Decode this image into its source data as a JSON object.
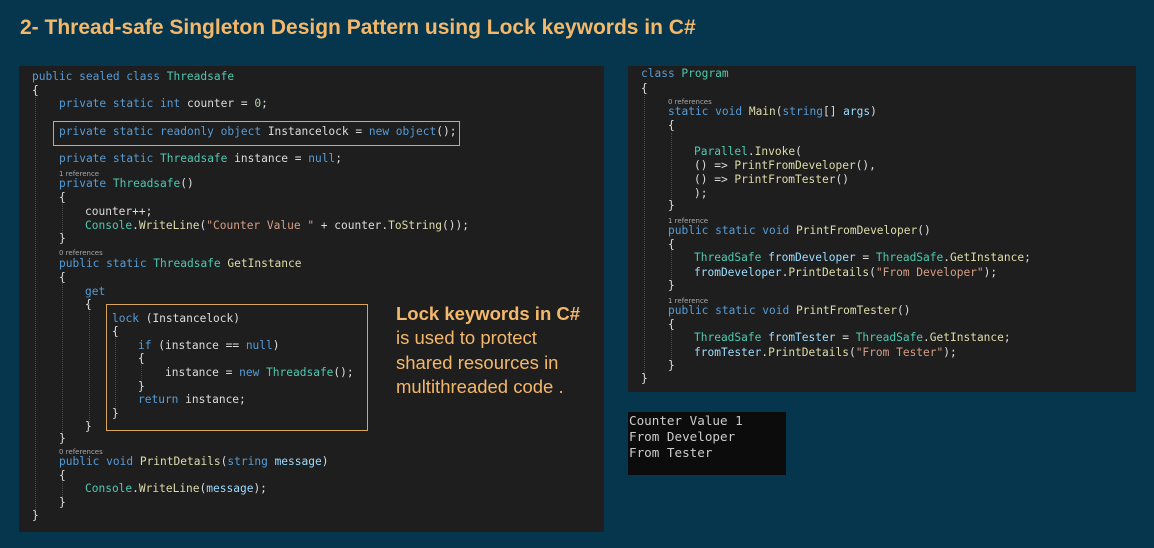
{
  "title": "2- Thread-safe Singleton Design Pattern using Lock keywords in C#",
  "references": {
    "one": "1 reference",
    "zero": "0 references"
  },
  "callout": {
    "heading": "Lock keywords in C#",
    "lines": [
      "is used to protect",
      "shared resources in",
      "multithreaded code ."
    ]
  },
  "console": {
    "lines": [
      "Counter Value 1",
      "From Developer",
      "From Tester"
    ]
  },
  "colors": {
    "background": "#06364e",
    "editor_background": "#1e1e1e",
    "console_background": "#0c0c0c",
    "accent": "#f4b86a",
    "highlight_border": "#d9a659",
    "keyword": "#569cd6",
    "type": "#4ec9b0",
    "method": "#dcdcaa",
    "string": "#d69d85",
    "number": "#b5cea8",
    "parameter": "#9cdcfe"
  },
  "left_code": {
    "class_name": "Threadsafe",
    "counter_field": "counter",
    "lock_field": "Instancelock",
    "instance_field": "instance",
    "constructor_name": "Threadsafe",
    "counter_label": "\"Counter Value \"",
    "get_method": "GetInstance",
    "print_method": "PrintDetails",
    "param_name": "message"
  },
  "right_code": {
    "class_name": "Program",
    "main_method": "Main",
    "args_param": "args",
    "dev_method": "PrintFromDeveloper",
    "tester_method": "PrintFromTester",
    "type_name": "ThreadSafe",
    "dev_var": "fromDeveloper",
    "tester_var": "fromTester",
    "dev_string": "\"From Developer\"",
    "tester_string": "\"From Tester\""
  }
}
